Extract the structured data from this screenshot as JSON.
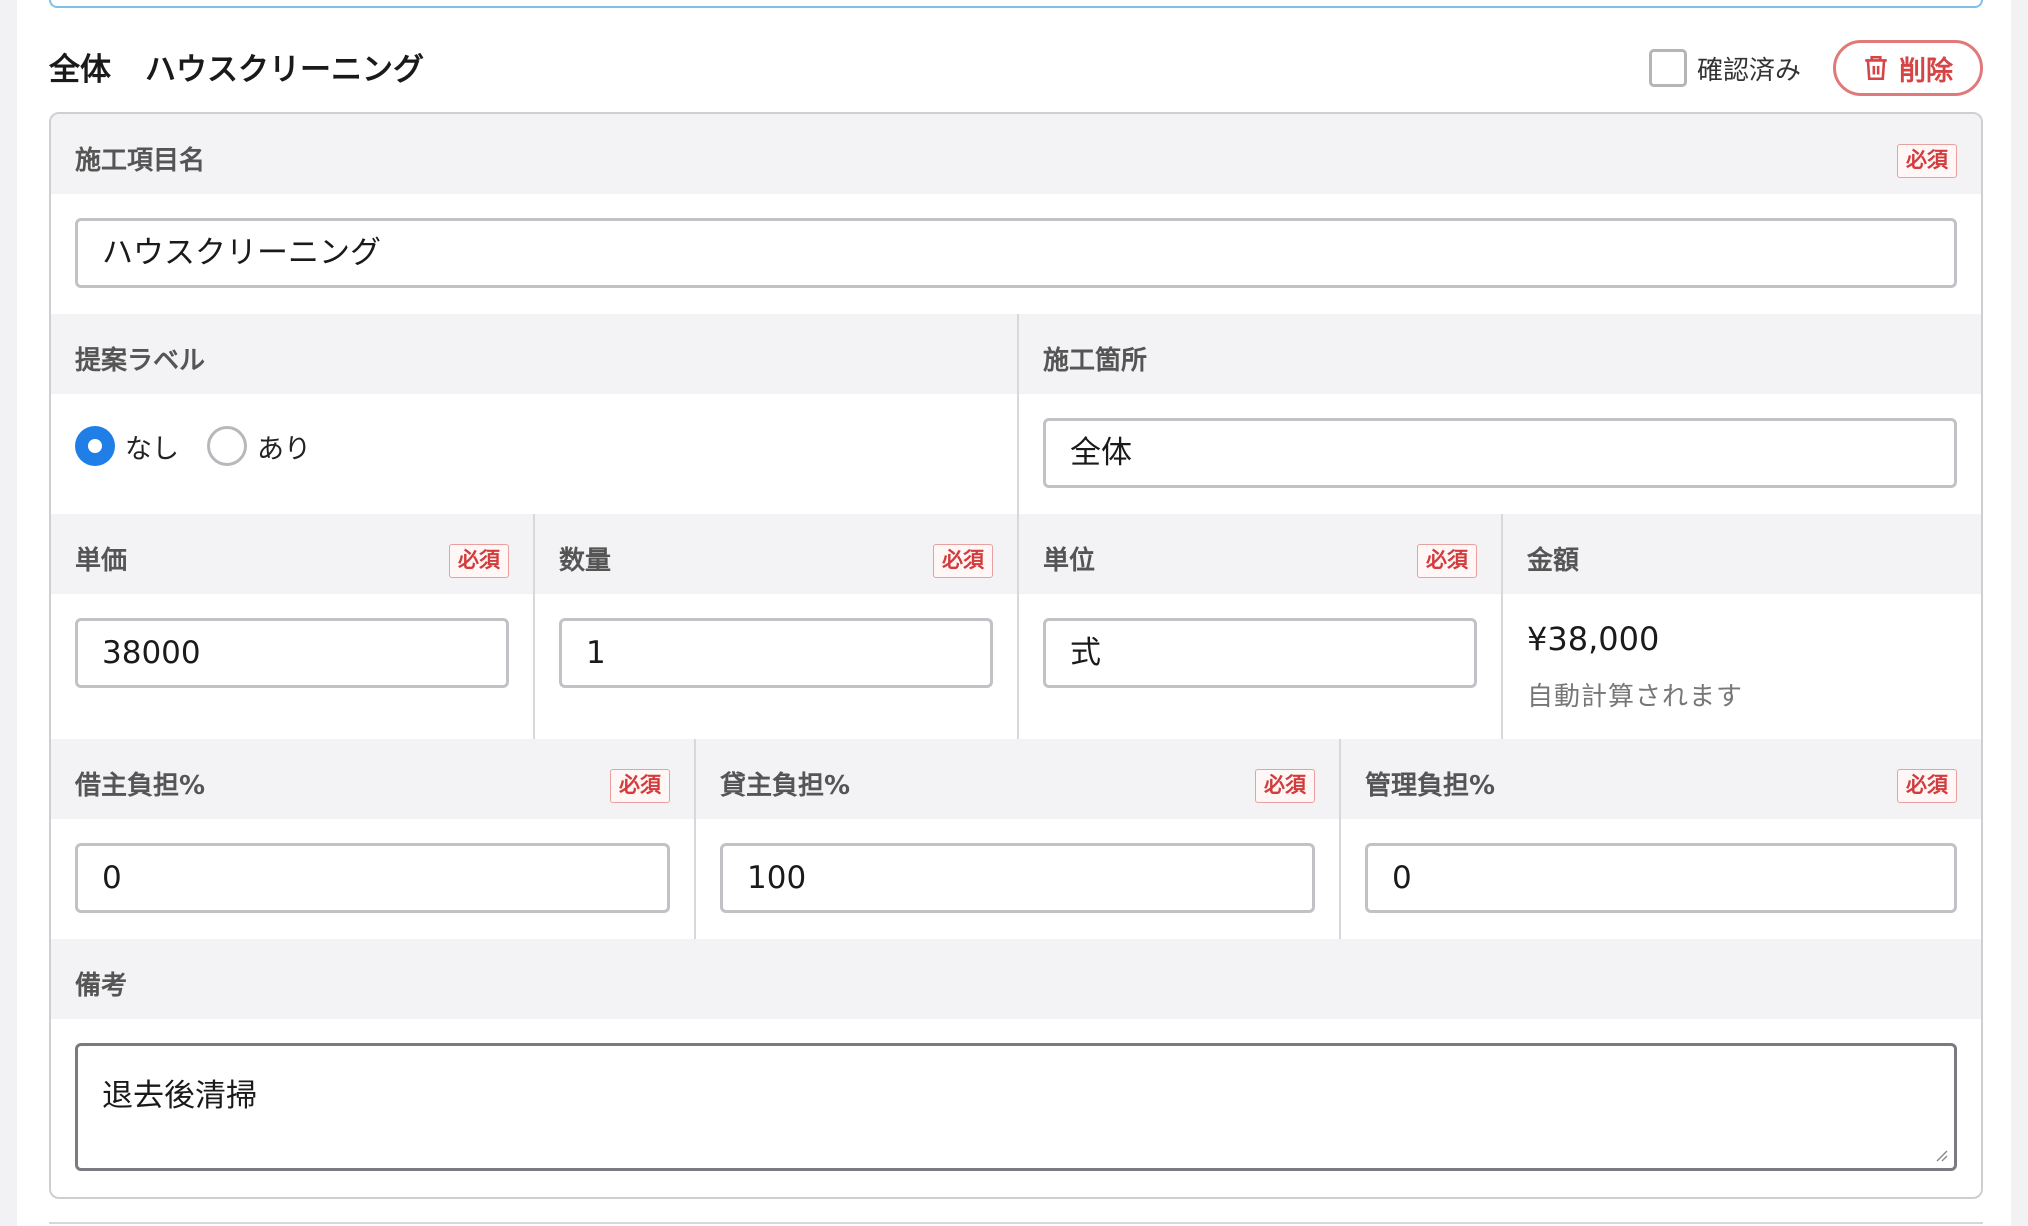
{
  "section": {
    "location": "全体",
    "item": "ハウスクリーニング",
    "confirm_label": "確認済み",
    "delete_label": "削除"
  },
  "required_badge": "必須",
  "fields": {
    "item_name": {
      "label": "施工項目名",
      "value": "ハウスクリーニング"
    },
    "proposal_label": {
      "label": "提案ラベル",
      "options": [
        "なし",
        "あり"
      ],
      "selected": "なし"
    },
    "location": {
      "label": "施工箇所",
      "value": "全体"
    },
    "unit_price": {
      "label": "単価",
      "value": "38000"
    },
    "quantity": {
      "label": "数量",
      "value": "1"
    },
    "unit": {
      "label": "単位",
      "value": "式"
    },
    "amount": {
      "label": "金額",
      "value": "¥38,000",
      "hint": "自動計算されます"
    },
    "tenant_share": {
      "label": "借主負担%",
      "value": "0"
    },
    "owner_share": {
      "label": "貸主負担%",
      "value": "100"
    },
    "management_share": {
      "label": "管理負担%",
      "value": "0"
    },
    "notes": {
      "label": "備考",
      "value": "退去後清掃"
    }
  },
  "colors": {
    "accent": "#1f7fe6",
    "danger": "#d64545",
    "label_bg": "#f3f3f5"
  }
}
